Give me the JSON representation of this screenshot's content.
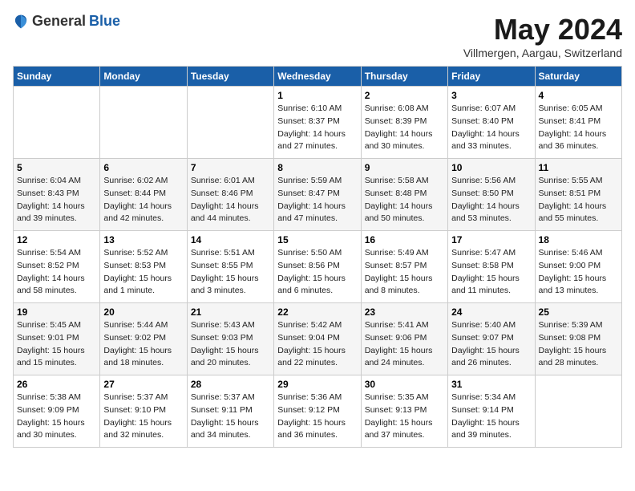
{
  "header": {
    "logo_general": "General",
    "logo_blue": "Blue",
    "title": "May 2024",
    "subtitle": "Villmergen, Aargau, Switzerland"
  },
  "days_of_week": [
    "Sunday",
    "Monday",
    "Tuesday",
    "Wednesday",
    "Thursday",
    "Friday",
    "Saturday"
  ],
  "weeks": [
    [
      {
        "day": "",
        "info": ""
      },
      {
        "day": "",
        "info": ""
      },
      {
        "day": "",
        "info": ""
      },
      {
        "day": "1",
        "info": "Sunrise: 6:10 AM\nSunset: 8:37 PM\nDaylight: 14 hours\nand 27 minutes."
      },
      {
        "day": "2",
        "info": "Sunrise: 6:08 AM\nSunset: 8:39 PM\nDaylight: 14 hours\nand 30 minutes."
      },
      {
        "day": "3",
        "info": "Sunrise: 6:07 AM\nSunset: 8:40 PM\nDaylight: 14 hours\nand 33 minutes."
      },
      {
        "day": "4",
        "info": "Sunrise: 6:05 AM\nSunset: 8:41 PM\nDaylight: 14 hours\nand 36 minutes."
      }
    ],
    [
      {
        "day": "5",
        "info": "Sunrise: 6:04 AM\nSunset: 8:43 PM\nDaylight: 14 hours\nand 39 minutes."
      },
      {
        "day": "6",
        "info": "Sunrise: 6:02 AM\nSunset: 8:44 PM\nDaylight: 14 hours\nand 42 minutes."
      },
      {
        "day": "7",
        "info": "Sunrise: 6:01 AM\nSunset: 8:46 PM\nDaylight: 14 hours\nand 44 minutes."
      },
      {
        "day": "8",
        "info": "Sunrise: 5:59 AM\nSunset: 8:47 PM\nDaylight: 14 hours\nand 47 minutes."
      },
      {
        "day": "9",
        "info": "Sunrise: 5:58 AM\nSunset: 8:48 PM\nDaylight: 14 hours\nand 50 minutes."
      },
      {
        "day": "10",
        "info": "Sunrise: 5:56 AM\nSunset: 8:50 PM\nDaylight: 14 hours\nand 53 minutes."
      },
      {
        "day": "11",
        "info": "Sunrise: 5:55 AM\nSunset: 8:51 PM\nDaylight: 14 hours\nand 55 minutes."
      }
    ],
    [
      {
        "day": "12",
        "info": "Sunrise: 5:54 AM\nSunset: 8:52 PM\nDaylight: 14 hours\nand 58 minutes."
      },
      {
        "day": "13",
        "info": "Sunrise: 5:52 AM\nSunset: 8:53 PM\nDaylight: 15 hours\nand 1 minute."
      },
      {
        "day": "14",
        "info": "Sunrise: 5:51 AM\nSunset: 8:55 PM\nDaylight: 15 hours\nand 3 minutes."
      },
      {
        "day": "15",
        "info": "Sunrise: 5:50 AM\nSunset: 8:56 PM\nDaylight: 15 hours\nand 6 minutes."
      },
      {
        "day": "16",
        "info": "Sunrise: 5:49 AM\nSunset: 8:57 PM\nDaylight: 15 hours\nand 8 minutes."
      },
      {
        "day": "17",
        "info": "Sunrise: 5:47 AM\nSunset: 8:58 PM\nDaylight: 15 hours\nand 11 minutes."
      },
      {
        "day": "18",
        "info": "Sunrise: 5:46 AM\nSunset: 9:00 PM\nDaylight: 15 hours\nand 13 minutes."
      }
    ],
    [
      {
        "day": "19",
        "info": "Sunrise: 5:45 AM\nSunset: 9:01 PM\nDaylight: 15 hours\nand 15 minutes."
      },
      {
        "day": "20",
        "info": "Sunrise: 5:44 AM\nSunset: 9:02 PM\nDaylight: 15 hours\nand 18 minutes."
      },
      {
        "day": "21",
        "info": "Sunrise: 5:43 AM\nSunset: 9:03 PM\nDaylight: 15 hours\nand 20 minutes."
      },
      {
        "day": "22",
        "info": "Sunrise: 5:42 AM\nSunset: 9:04 PM\nDaylight: 15 hours\nand 22 minutes."
      },
      {
        "day": "23",
        "info": "Sunrise: 5:41 AM\nSunset: 9:06 PM\nDaylight: 15 hours\nand 24 minutes."
      },
      {
        "day": "24",
        "info": "Sunrise: 5:40 AM\nSunset: 9:07 PM\nDaylight: 15 hours\nand 26 minutes."
      },
      {
        "day": "25",
        "info": "Sunrise: 5:39 AM\nSunset: 9:08 PM\nDaylight: 15 hours\nand 28 minutes."
      }
    ],
    [
      {
        "day": "26",
        "info": "Sunrise: 5:38 AM\nSunset: 9:09 PM\nDaylight: 15 hours\nand 30 minutes."
      },
      {
        "day": "27",
        "info": "Sunrise: 5:37 AM\nSunset: 9:10 PM\nDaylight: 15 hours\nand 32 minutes."
      },
      {
        "day": "28",
        "info": "Sunrise: 5:37 AM\nSunset: 9:11 PM\nDaylight: 15 hours\nand 34 minutes."
      },
      {
        "day": "29",
        "info": "Sunrise: 5:36 AM\nSunset: 9:12 PM\nDaylight: 15 hours\nand 36 minutes."
      },
      {
        "day": "30",
        "info": "Sunrise: 5:35 AM\nSunset: 9:13 PM\nDaylight: 15 hours\nand 37 minutes."
      },
      {
        "day": "31",
        "info": "Sunrise: 5:34 AM\nSunset: 9:14 PM\nDaylight: 15 hours\nand 39 minutes."
      },
      {
        "day": "",
        "info": ""
      }
    ]
  ]
}
